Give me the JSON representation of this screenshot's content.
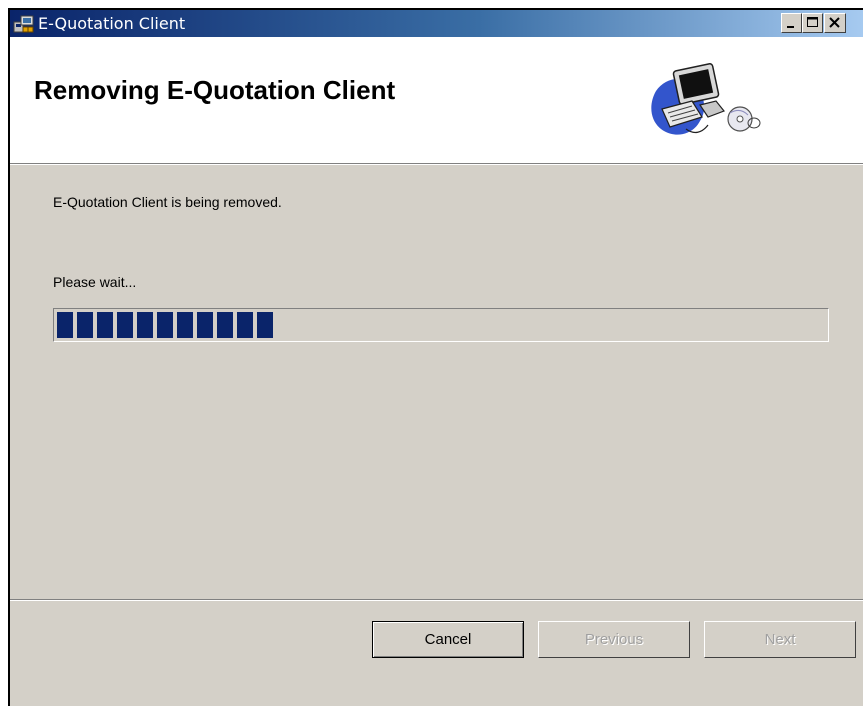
{
  "window": {
    "title": "E-Quotation Client",
    "app_icon": "installer-icon",
    "controls": [
      "minimize-icon",
      "maximize-icon",
      "close-icon"
    ]
  },
  "banner": {
    "title": "Removing E-Quotation Client",
    "graphic": "computer-clipart-icon"
  },
  "content": {
    "status": "E-Quotation Client is being removed.",
    "wait": "Please wait...",
    "progress_fraction": 0.29
  },
  "buttons": {
    "cancel": "Cancel",
    "previous": "Previous",
    "next": "Next"
  },
  "colors": {
    "titlebar_start": "#0a246a",
    "progress": "#0a246a",
    "dialog_bg": "#d4d0c8"
  }
}
